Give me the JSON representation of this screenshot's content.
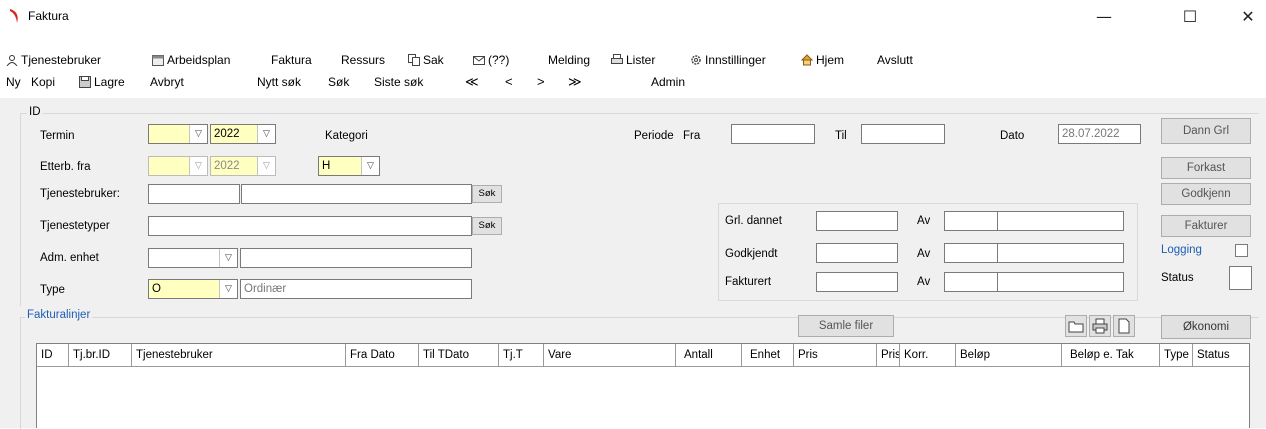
{
  "window": {
    "title": "Faktura",
    "minimize": "—",
    "maximize": "☐",
    "close": "✕"
  },
  "menu": {
    "tjenestebruker": "Tjenestebruker",
    "arbeidsplan": "Arbeidsplan",
    "faktura": "Faktura",
    "ressurs": "Ressurs",
    "sak": "Sak",
    "meldinger": "(??)",
    "melding": "Melding",
    "lister": "Lister",
    "innstillinger": "Innstillinger",
    "hjem": "Hjem",
    "avslutt": "Avslutt"
  },
  "toolbar": {
    "ny": "Ny",
    "kopi": "Kopi",
    "lagre": "Lagre",
    "avbryt": "Avbryt",
    "nytt_sok": "Nytt søk",
    "sok": "Søk",
    "siste_sok": "Siste søk",
    "first": "≪",
    "prev": "<",
    "next": ">",
    "last": "≫",
    "admin": "Admin"
  },
  "form": {
    "group_label": "ID",
    "termin_label": "Termin",
    "termin_year": "2022",
    "kategori_label": "Kategori",
    "kategori_value": "H",
    "etterb_label": "Etterb. fra",
    "etterb_year": "2022",
    "tjenestebruker_label": "Tjenestebruker:",
    "tjenestetyper_label": "Tjenestetyper",
    "adm_label": "Adm. enhet",
    "type_label": "Type",
    "type_value": "O",
    "type_text": "Ordinær",
    "sok_btn": "Søk",
    "periode_label": "Periode",
    "fra_label": "Fra",
    "til_label": "Til",
    "dato_label": "Dato",
    "dato_value": "28.07.2022",
    "grl_label": "Grl. dannet",
    "godkjendt_label": "Godkjendt",
    "fakturert_label": "Fakturert",
    "av_label": "Av"
  },
  "side_buttons": {
    "dann": "Dann Grl",
    "forkast": "Forkast",
    "godkjenn": "Godkjenn",
    "fakturer": "Fakturer",
    "logging": "Logging",
    "status": "Status"
  },
  "lines": {
    "group_label": "Fakturalinjer",
    "samle": "Samle filer",
    "okonomi": "Økonomi",
    "columns": [
      "ID",
      "Tj.br.ID",
      "Tjenestebruker",
      "Fra Dato",
      "Til TDato",
      "Tj.T",
      "Vare",
      "Antall",
      "Enhet",
      "Pris",
      "Pris",
      "Korr.",
      "Beløp",
      "Beløp e. Tak",
      "Type",
      "Status"
    ]
  }
}
